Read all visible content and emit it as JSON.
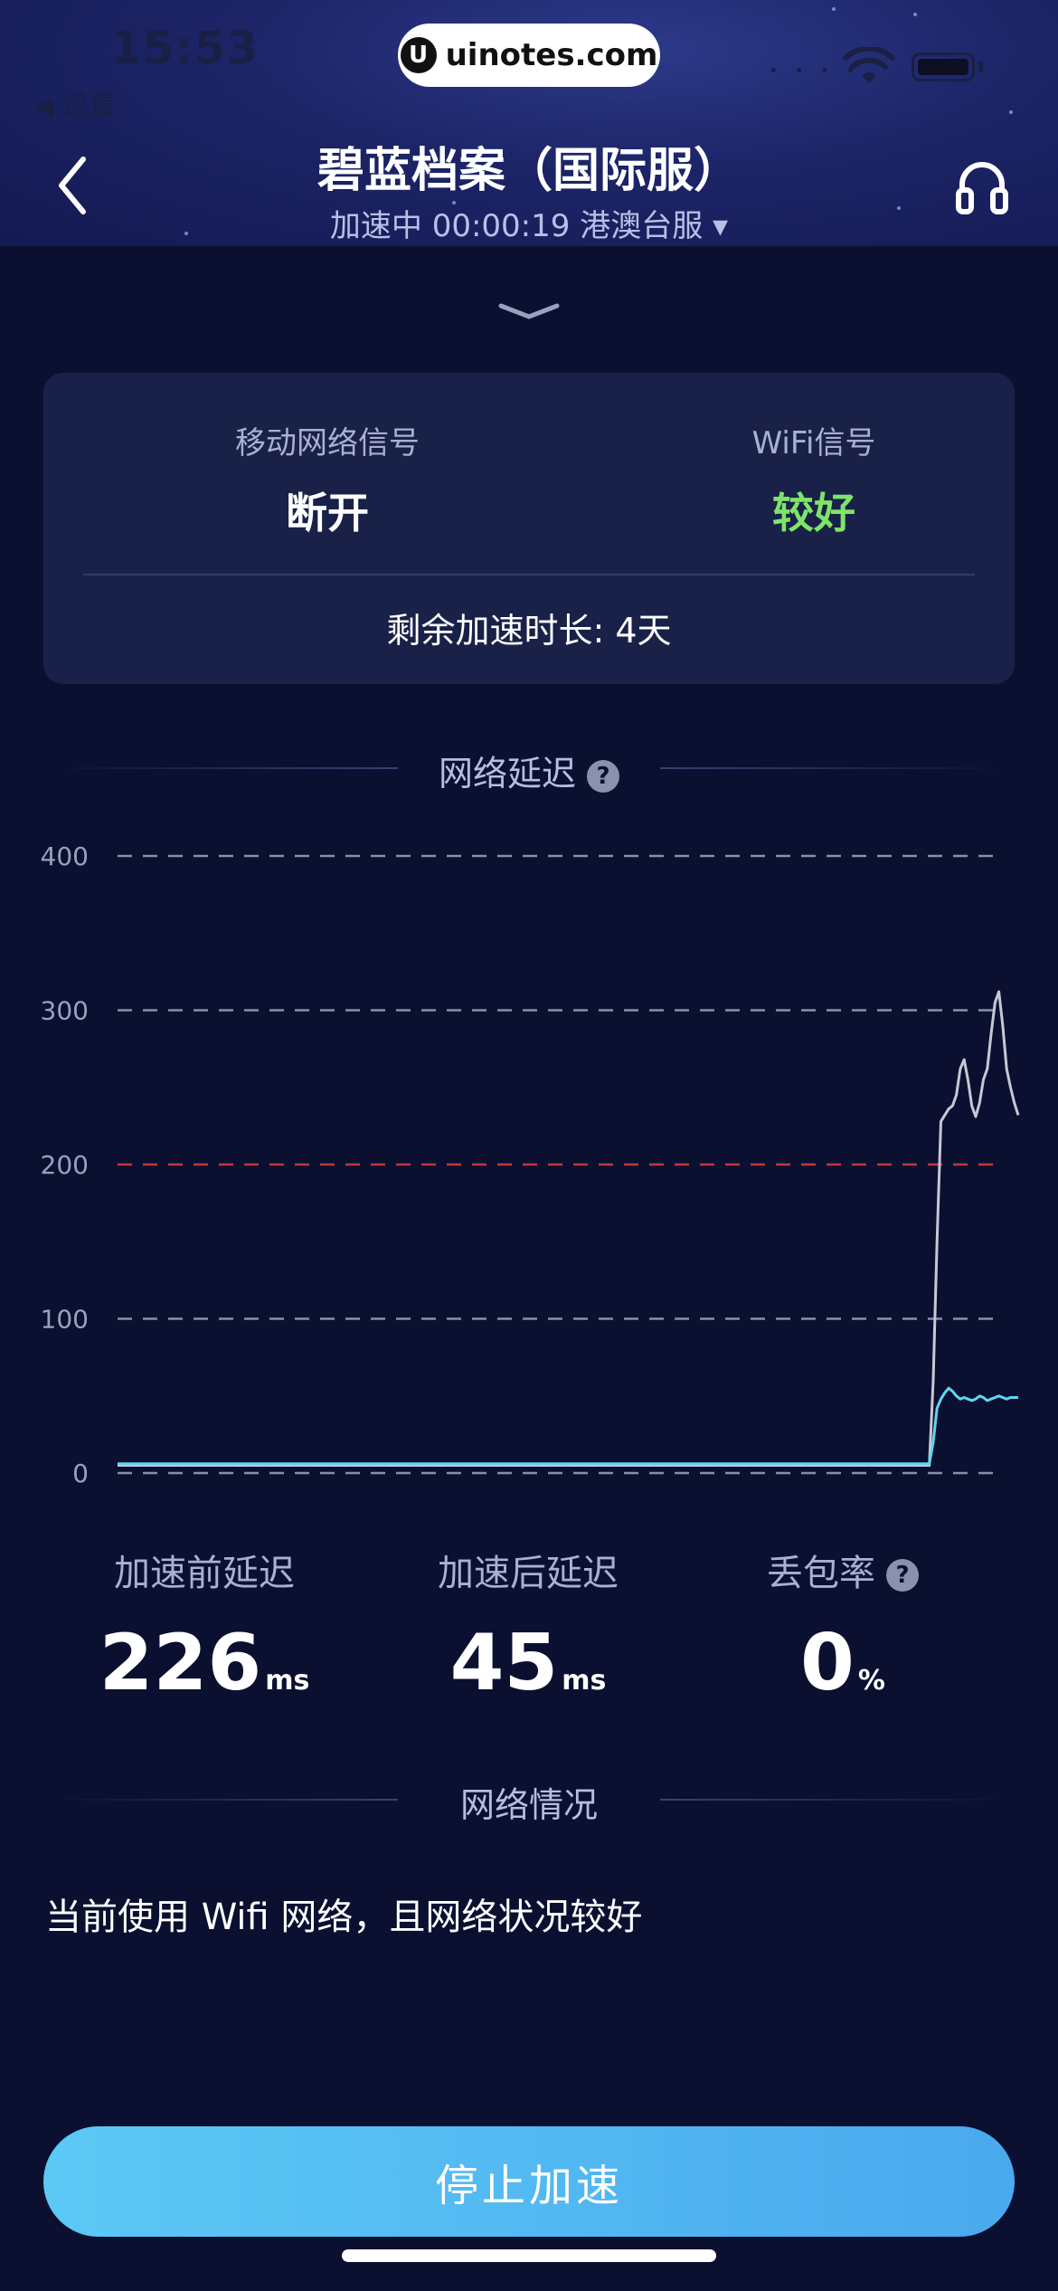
{
  "status_bar": {
    "time": "15:53",
    "back_app": "◀ 设置"
  },
  "watermark": {
    "text": "uinotes.com",
    "logo": "U"
  },
  "nav": {
    "title": "碧蓝档案（国际服）",
    "subtitle": "加速中 00:00:19 港澳台服 ▾",
    "back_icon": "chevron-left-icon",
    "service_icon": "headset-icon"
  },
  "signal_card": {
    "mobile_label": "移动网络信号",
    "mobile_value": "断开",
    "wifi_label": "WiFi信号",
    "wifi_value": "较好",
    "wifi_value_color": "#7fe46a",
    "remaining": "剩余加速时长: 4天"
  },
  "latency_section": {
    "title": "网络延迟"
  },
  "chart_data": {
    "type": "line",
    "title": "",
    "xlabel": "",
    "ylabel": "",
    "ylim": [
      0,
      400
    ],
    "yticks": [
      "400",
      "300",
      "200",
      "100",
      "0"
    ],
    "threshold": {
      "value": 200,
      "color": "#c0393b"
    },
    "grid": "dashed",
    "series": [
      {
        "color": "#c8c8d4",
        "values": [
          5,
          5,
          5,
          5,
          5,
          5,
          5,
          5,
          5,
          5,
          5,
          5,
          5,
          5,
          5,
          5,
          5,
          5,
          5,
          5,
          5,
          5,
          5,
          5,
          5,
          5,
          5,
          5,
          5,
          5,
          5,
          5,
          5,
          5,
          5,
          5,
          5,
          5,
          5,
          5,
          5,
          5,
          5,
          5,
          5,
          5,
          5,
          5,
          5,
          5,
          5,
          5,
          5,
          5,
          5,
          5,
          5,
          5,
          5,
          5,
          5,
          5,
          5,
          5,
          5,
          5,
          5,
          5,
          5,
          5,
          5,
          5,
          5,
          5,
          5,
          5,
          5,
          5,
          5,
          5,
          5,
          5,
          5,
          5,
          5,
          5,
          5,
          5,
          5,
          5,
          5,
          5,
          5,
          5,
          5,
          5,
          5,
          5,
          5,
          5,
          5,
          5,
          5,
          5,
          5,
          5,
          5,
          5,
          5,
          5,
          5,
          5,
          5,
          5,
          5,
          5,
          5,
          5,
          5,
          5,
          5,
          5,
          5,
          5,
          5,
          5,
          5,
          5,
          5,
          5,
          5,
          5,
          5,
          5,
          5,
          5,
          5,
          5,
          5,
          5,
          5,
          5,
          5,
          5,
          5,
          5,
          5,
          5,
          5,
          5,
          5,
          5,
          5,
          5,
          5,
          5,
          5,
          5,
          5,
          5,
          5,
          5,
          5,
          5,
          5,
          5,
          5,
          5,
          5,
          5,
          5,
          5,
          5,
          5,
          5,
          5,
          5,
          5,
          5,
          5,
          5,
          5,
          5,
          5,
          5,
          5,
          5,
          5,
          5,
          5,
          5,
          5,
          5,
          5,
          5,
          5,
          5,
          5,
          5,
          5,
          5,
          5,
          5,
          5,
          5,
          5,
          5,
          5,
          5,
          5,
          5,
          60,
          150,
          228,
          232,
          236,
          238,
          245,
          262,
          268,
          255,
          238,
          231,
          240,
          255,
          262,
          285,
          305,
          312,
          290,
          262,
          250,
          240,
          232
        ]
      },
      {
        "color": "#5fd6f0",
        "values": [
          6,
          6,
          6,
          6,
          6,
          6,
          6,
          6,
          6,
          6,
          6,
          6,
          6,
          6,
          6,
          6,
          6,
          6,
          6,
          6,
          6,
          6,
          6,
          6,
          6,
          6,
          6,
          6,
          6,
          6,
          6,
          6,
          6,
          6,
          6,
          6,
          6,
          6,
          6,
          6,
          6,
          6,
          6,
          6,
          6,
          6,
          6,
          6,
          6,
          6,
          6,
          6,
          6,
          6,
          6,
          6,
          6,
          6,
          6,
          6,
          6,
          6,
          6,
          6,
          6,
          6,
          6,
          6,
          6,
          6,
          6,
          6,
          6,
          6,
          6,
          6,
          6,
          6,
          6,
          6,
          6,
          6,
          6,
          6,
          6,
          6,
          6,
          6,
          6,
          6,
          6,
          6,
          6,
          6,
          6,
          6,
          6,
          6,
          6,
          6,
          6,
          6,
          6,
          6,
          6,
          6,
          6,
          6,
          6,
          6,
          6,
          6,
          6,
          6,
          6,
          6,
          6,
          6,
          6,
          6,
          6,
          6,
          6,
          6,
          6,
          6,
          6,
          6,
          6,
          6,
          6,
          6,
          6,
          6,
          6,
          6,
          6,
          6,
          6,
          6,
          6,
          6,
          6,
          6,
          6,
          6,
          6,
          6,
          6,
          6,
          6,
          6,
          6,
          6,
          6,
          6,
          6,
          6,
          6,
          6,
          6,
          6,
          6,
          6,
          6,
          6,
          6,
          6,
          6,
          6,
          6,
          6,
          6,
          6,
          6,
          6,
          6,
          6,
          6,
          6,
          6,
          6,
          6,
          6,
          6,
          6,
          6,
          6,
          6,
          6,
          6,
          6,
          6,
          6,
          6,
          6,
          6,
          6,
          6,
          6,
          6,
          6,
          6,
          6,
          6,
          6,
          6,
          6,
          6,
          6,
          6,
          20,
          42,
          48,
          52,
          55,
          53,
          50,
          48,
          49,
          48,
          47,
          48,
          50,
          49,
          47,
          48,
          49,
          50,
          49,
          48,
          49,
          49,
          49
        ]
      }
    ]
  },
  "stats": [
    {
      "label": "加速前延迟",
      "value": "226",
      "unit": "ms"
    },
    {
      "label": "加速后延迟",
      "value": "45",
      "unit": "ms"
    },
    {
      "label": "丢包率",
      "value": "0",
      "unit": "%"
    }
  ],
  "network_section": {
    "title": "网络情况",
    "status": "当前使用 Wifi 网络，且网络状况较好"
  },
  "stop_button": {
    "label": "停止加速"
  }
}
